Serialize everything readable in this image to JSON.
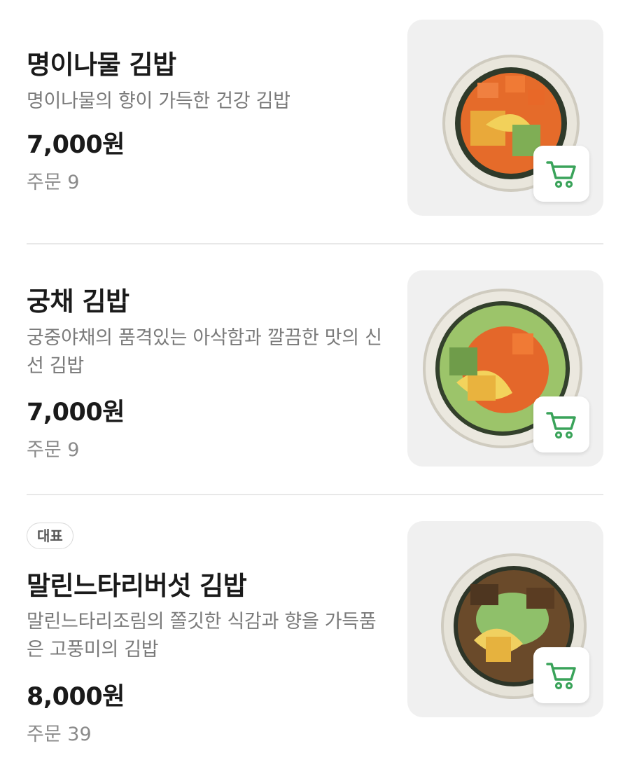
{
  "menu": {
    "items": [
      {
        "title": "명이나물 김밥",
        "description": "명이나물의 향이 가득한 건강 김밥",
        "price": "7,000원",
        "orders": "주문 9",
        "badge": null,
        "image": "kimbap-photo"
      },
      {
        "title": "궁채 김밥",
        "description": "궁중야채의 품격있는 아삭함과 깔끔한 맛의 신선 김밥",
        "price": "7,000원",
        "orders": "주문 9",
        "badge": null,
        "image": "kimbap-photo"
      },
      {
        "title": "말린느타리버섯 김밥",
        "description": "말린느타리조림의 쫄깃한 식감과 향을 가득품은 고풍미의 김밥",
        "price": "8,000원",
        "orders": "주문 39",
        "badge": "대표",
        "image": "kimbap-photo"
      }
    ],
    "cart_icon": "shopping-cart-icon"
  },
  "colors": {
    "accent_green": "#3aa35a",
    "title_text": "#1a1a1a",
    "secondary_text": "#7a7a7a",
    "image_background": "#f0f0f0",
    "divider": "#e8e8e8"
  }
}
